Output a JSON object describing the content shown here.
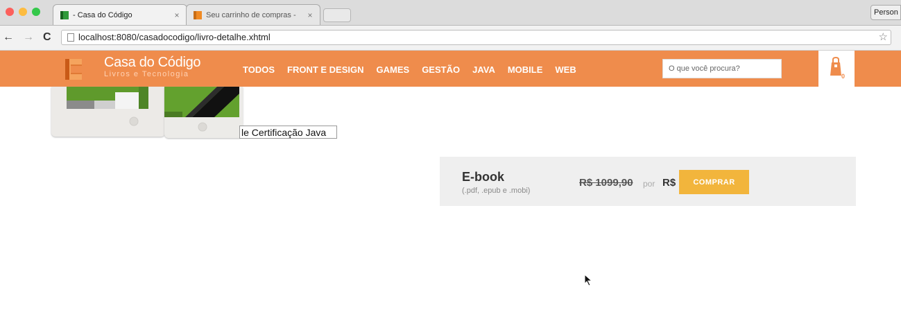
{
  "browser": {
    "tabs": [
      {
        "label": "- Casa do Código",
        "close": "×",
        "active": true
      },
      {
        "label": "Seu carrinho de compras -",
        "close": "×",
        "active": false
      }
    ],
    "profile_label": "Person",
    "url": "localhost:8080/casadocodigo/livro-detalhe.xhtml",
    "back_icon": "←",
    "forward_icon": "→",
    "reload_icon": "C",
    "star_icon": "☆"
  },
  "site": {
    "logo_title": "Casa do Código",
    "logo_subtitle": "Livros e Tecnologia",
    "categories": [
      "TODOS",
      "FRONT E DESIGN",
      "GAMES",
      "GESTÃO",
      "JAVA",
      "MOBILE",
      "WEB"
    ],
    "search_placeholder": "O que você procura?",
    "cart_count": "0",
    "brand_color": "#ef8c4c"
  },
  "product": {
    "title": "Livro de Certificação Java",
    "title_visible": "le Certificação Java",
    "format_label": "E-book",
    "format_details": "(.pdf, .epub e .mobi)",
    "old_price": "R$ 1099,90",
    "por_label": "por",
    "new_price": "R$",
    "buy_label": "COMPRAR",
    "buy_color": "#f2b53c"
  }
}
